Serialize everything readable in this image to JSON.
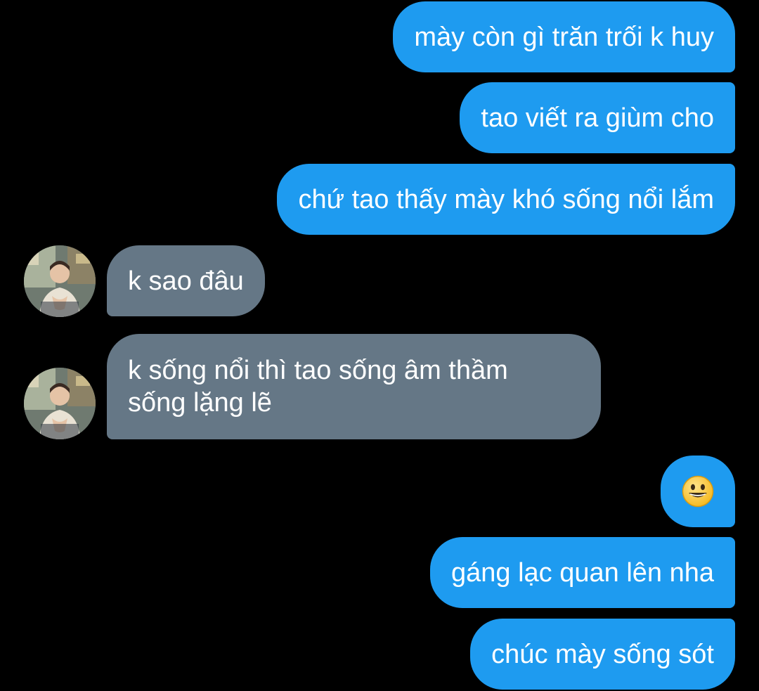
{
  "colors": {
    "background": "#000000",
    "sent_bubble": "#1e9bf0",
    "received_bubble": "#657786",
    "text": "#ffffff"
  },
  "messages": [
    {
      "direction": "sent",
      "text": "mày còn gì trăn trối k huy"
    },
    {
      "direction": "sent",
      "text": "tao viết ra giùm cho"
    },
    {
      "direction": "sent",
      "text": "chứ tao thấy mày khó sống nổi lắm"
    },
    {
      "direction": "received",
      "text": "k sao đâu"
    },
    {
      "direction": "received",
      "lines": [
        "k sống nổi thì tao sống âm thầm",
        "sống lặng lẽ"
      ]
    },
    {
      "direction": "sent",
      "emoji": "grinning-face-emoji"
    },
    {
      "direction": "sent",
      "text": "gáng lạc quan lên nha"
    },
    {
      "direction": "sent",
      "text": "chúc mày sống sót"
    }
  ]
}
